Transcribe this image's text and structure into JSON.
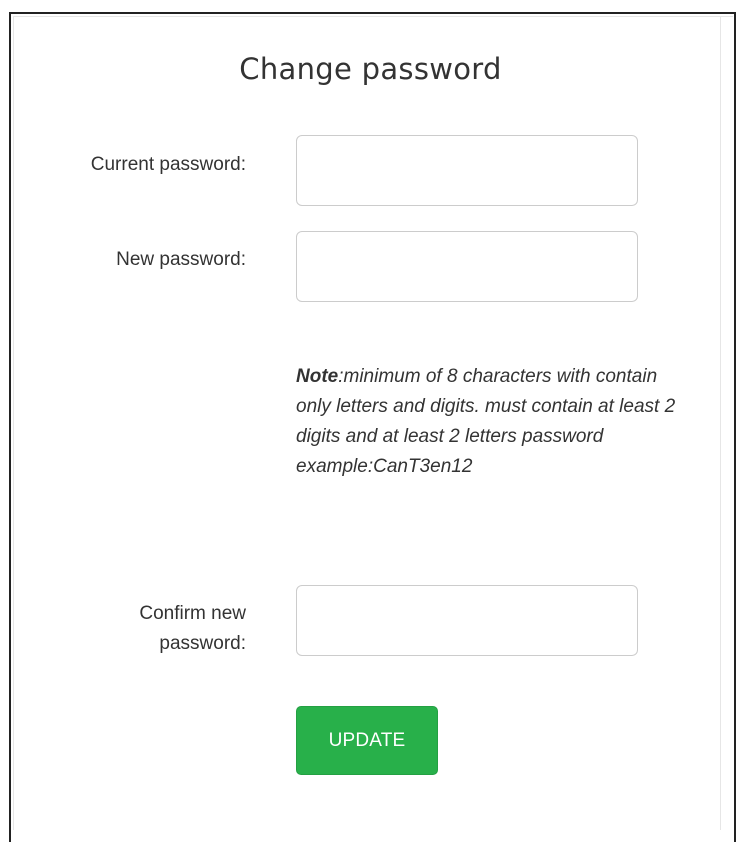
{
  "form": {
    "title": "Change password",
    "current_password": {
      "label": "Current password:",
      "value": "",
      "placeholder": ""
    },
    "new_password": {
      "label": "New password:",
      "value": "",
      "placeholder": ""
    },
    "note": {
      "bold": "Note",
      "text": ":minimum of 8 characters with contain only letters and digits. must contain at least 2 digits and at least 2 letters password example:CanT3en12"
    },
    "confirm_password": {
      "label_line1": "Confirm new",
      "label_line2": "password:",
      "value": "",
      "placeholder": ""
    },
    "update_label": "UPDATE"
  },
  "colors": {
    "button": "#28b04a",
    "text": "#333333",
    "border": "#cccccc"
  }
}
